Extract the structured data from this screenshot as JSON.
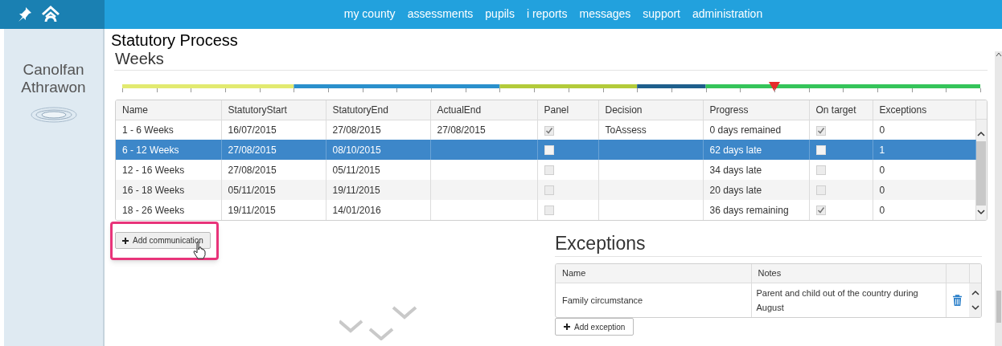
{
  "nav": {
    "items": [
      "my county",
      "assessments",
      "pupils",
      "i reports",
      "messages",
      "support",
      "administration"
    ]
  },
  "sidebar": {
    "title": "Canolfan Athrawon"
  },
  "page_title": "Statutory Process",
  "weeks": {
    "heading": "Weeks",
    "timeline": {
      "marker": {
        "level": 0.76
      }
    },
    "table": {
      "columns": [
        "Name",
        "StatutoryStart",
        "StatutoryEnd",
        "ActualEnd",
        "Panel",
        "Decision",
        "Progress",
        "On target",
        "Exceptions"
      ],
      "rows": [
        {
          "name": "1 - 6 Weeks",
          "statutory_start": "16/07/2015",
          "statutory_end": "27/08/2015",
          "actual_end": "27/08/2015",
          "panel": true,
          "decision": "ToAssess",
          "progress": "0 days remained",
          "on_target": true,
          "exceptions": "0",
          "selected": false
        },
        {
          "name": "6 - 12 Weeks",
          "statutory_start": "27/08/2015",
          "statutory_end": "08/10/2015",
          "panel": false,
          "progress": "62 days late",
          "on_target": false,
          "exceptions": "1",
          "selected": true
        },
        {
          "name": "12 - 16 Weeks",
          "statutory_start": "27/08/2015",
          "statutory_end": "05/11/2015",
          "panel": false,
          "progress": "34 days late",
          "on_target": false,
          "exceptions": "0",
          "selected": false
        },
        {
          "name": "16 - 18 Weeks",
          "statutory_start": "05/11/2015",
          "statutory_end": "19/11/2015",
          "panel": false,
          "progress": "20 days late",
          "on_target": false,
          "exceptions": "0",
          "selected": false
        },
        {
          "name": "18 - 26 Weeks",
          "statutory_start": "19/11/2015",
          "statutory_end": "14/01/2016",
          "panel": false,
          "progress": "36 days remaining",
          "on_target": true,
          "exceptions": "0",
          "selected": false
        }
      ]
    },
    "add_button": "Add communication"
  },
  "exceptions": {
    "heading": "Exceptions",
    "columns": [
      "Name",
      "Notes"
    ],
    "rows": [
      {
        "name": "Family circumstance",
        "notes": "Parent and child out of the country during August"
      }
    ],
    "add_button": "Add exception"
  }
}
